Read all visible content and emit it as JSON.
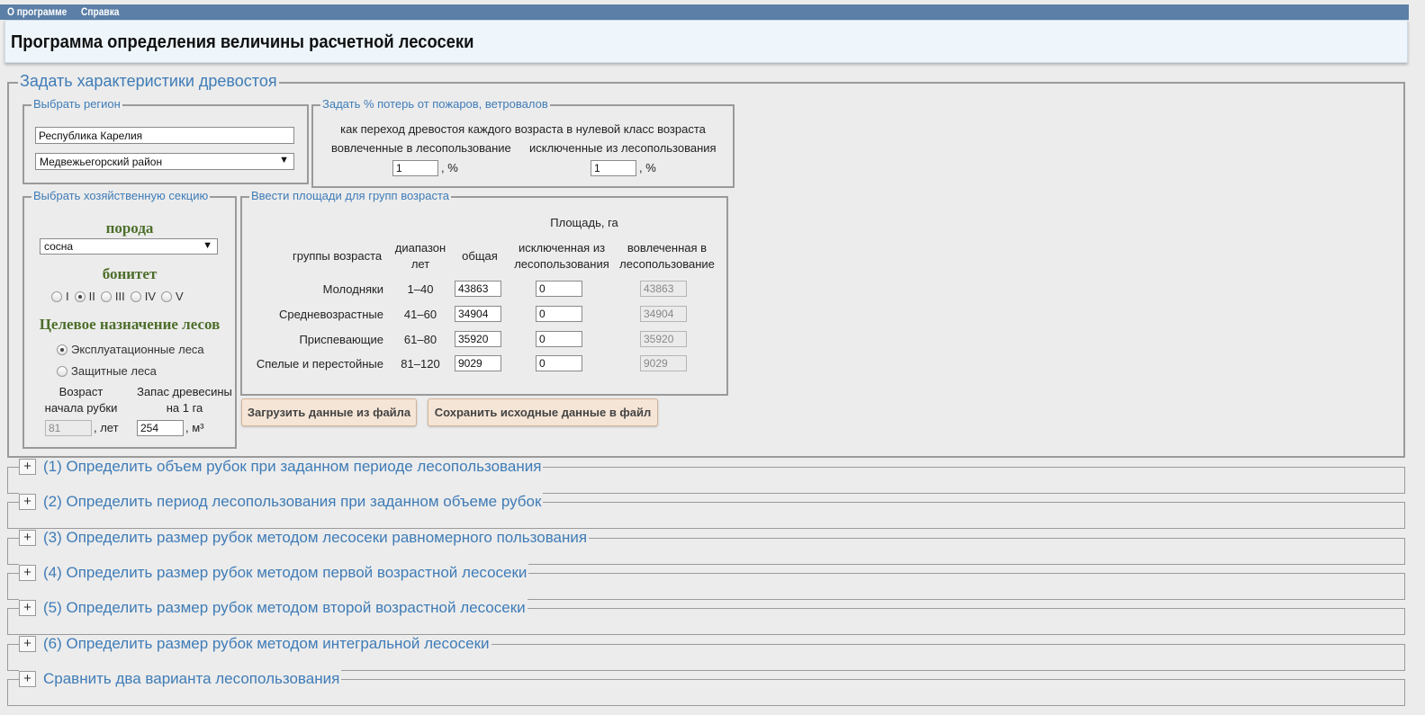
{
  "menu": {
    "about": "О программе",
    "help": "Справка"
  },
  "title": "Программа определения величины расчетной лесосеки",
  "main_section": {
    "legend": "Задать характеристики древостоя",
    "region": {
      "legend": "Выбрать регион",
      "region_value": "Республика Карелия",
      "district_value": "Медвежьегорский район"
    },
    "losses": {
      "legend": "Задать % потерь от пожаров, ветровалов",
      "description": "как переход древостоя каждого возраста в нулевой класс возраста",
      "involved_label": "вовлеченные в лесопользование",
      "excluded_label": "исключенные из лесопользования",
      "involved_value": "1",
      "excluded_value": "1",
      "unit": ", %"
    },
    "section": {
      "legend": "Выбрать хозяйственную секцию",
      "species_label": "порода",
      "species_value": "сосна",
      "bonitet_label": "бонитет",
      "bonitet_options": [
        "I",
        "II",
        "III",
        "IV",
        "V"
      ],
      "bonitet_selected": "II",
      "purpose_label": "Целевое назначение лесов",
      "purpose_options": [
        "Эксплуатационные леса",
        "Защитные леса"
      ],
      "purpose_selected": "Эксплуатационные леса",
      "age_label_1": "Возраст",
      "age_label_2": "начала рубки",
      "age_value": "81",
      "age_unit": ", лет",
      "stock_label_1": "Запас древесины",
      "stock_label_2": "на 1 га",
      "stock_value": "254",
      "stock_unit": ", м³"
    },
    "areas": {
      "legend": "Ввести площади для групп возраста",
      "area_header": "Площадь, га",
      "col_groups": "группы возраста",
      "col_range_1": "диапазон",
      "col_range_2": "лет",
      "col_total": "общая",
      "col_excluded_1": "исключенная из",
      "col_excluded_2": "лесопользования",
      "col_involved_1": "вовлеченная в",
      "col_involved_2": "лесопользование",
      "rows": [
        {
          "group": "Молодняки",
          "range": "1–40",
          "total": "43863",
          "excluded": "0",
          "involved": "43863"
        },
        {
          "group": "Средневозрастные",
          "range": "41–60",
          "total": "34904",
          "excluded": "0",
          "involved": "34904"
        },
        {
          "group": "Приспевающие",
          "range": "61–80",
          "total": "35920",
          "excluded": "0",
          "involved": "35920"
        },
        {
          "group": "Спелые и перестойные",
          "range": "81–120",
          "total": "9029",
          "excluded": "0",
          "involved": "9029"
        }
      ]
    },
    "buttons": {
      "load": "Загрузить данные из файла",
      "save": "Сохранить исходные данные в файл"
    }
  },
  "collapsed_sections": [
    {
      "toggle": "+",
      "title": "(1) Определить объем рубок при заданном периоде лесопользования"
    },
    {
      "toggle": "+",
      "title": "(2) Определить период лесопользования при заданном объеме рубок"
    },
    {
      "toggle": "+",
      "title": "(3) Определить размер рубок методом лесосеки равномерного пользования"
    },
    {
      "toggle": "+",
      "title": "(4) Определить размер рубок методом первой возрастной лесосеки"
    },
    {
      "toggle": "+",
      "title": "(5) Определить размер рубок методом второй возрастной лесосеки"
    },
    {
      "toggle": "+",
      "title": "(6) Определить размер рубок методом интегральной лесосеки"
    },
    {
      "toggle": "+",
      "title": "Сравнить два варианта лесопользования"
    }
  ],
  "colors": {
    "menubar": "#5b7fa6",
    "legend": "#3f7cb7",
    "green_label": "#4d6e2a",
    "button_bg": "#f5e5d6"
  }
}
